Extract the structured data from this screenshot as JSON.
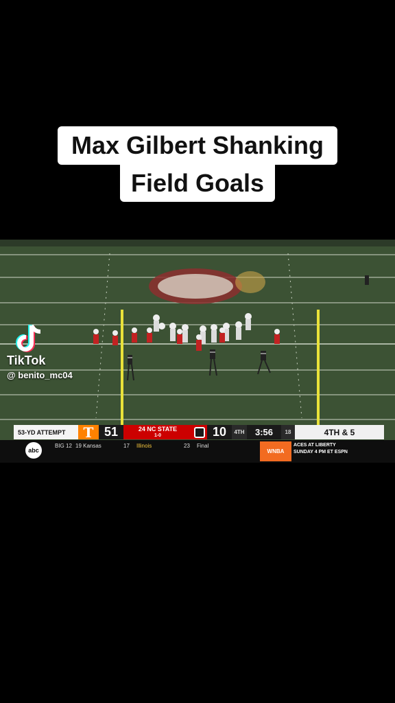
{
  "caption": {
    "line1": "Max Gilbert Shanking",
    "line2": "Field Goals"
  },
  "scoreboard": {
    "attempt": "53-YD ATTEMPT",
    "team1_logo": "T",
    "team1_score": "51",
    "team2_name": "24 NC STATE",
    "team2_record": "1-0",
    "team2_score": "10",
    "quarter": "4TH",
    "clock": "3:56",
    "play_clock": "18",
    "down_distance": "4TH & 5",
    "colors": {
      "tennessee": "#ff8200",
      "ncstate": "#cc0000"
    }
  },
  "ticker": {
    "network": "abc",
    "conference": "BIG 12",
    "team_a_rank_name": "19 Kansas",
    "team_a_score": "17",
    "team_b_name": "Illinois",
    "team_b_score": "23",
    "status": "Final",
    "promo_logo": "WNBA",
    "promo_line1": "ACES AT LIBERTY",
    "promo_line2": "SUNDAY 4 PM ET ESPN"
  },
  "watermark": {
    "brand": "TikTok",
    "username": "@ benito_mc04",
    "icon": "tiktok-note-icon"
  }
}
